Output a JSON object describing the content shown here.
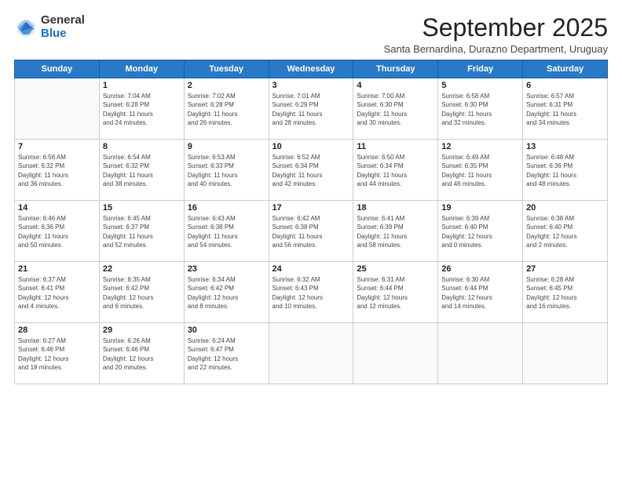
{
  "logo": {
    "general": "General",
    "blue": "Blue"
  },
  "title": "September 2025",
  "subtitle": "Santa Bernardina, Durazno Department, Uruguay",
  "weekdays": [
    "Sunday",
    "Monday",
    "Tuesday",
    "Wednesday",
    "Thursday",
    "Friday",
    "Saturday"
  ],
  "weeks": [
    [
      {
        "day": "",
        "info": ""
      },
      {
        "day": "1",
        "info": "Sunrise: 7:04 AM\nSunset: 6:28 PM\nDaylight: 11 hours\nand 24 minutes."
      },
      {
        "day": "2",
        "info": "Sunrise: 7:02 AM\nSunset: 6:28 PM\nDaylight: 11 hours\nand 26 minutes."
      },
      {
        "day": "3",
        "info": "Sunrise: 7:01 AM\nSunset: 6:29 PM\nDaylight: 11 hours\nand 28 minutes."
      },
      {
        "day": "4",
        "info": "Sunrise: 7:00 AM\nSunset: 6:30 PM\nDaylight: 11 hours\nand 30 minutes."
      },
      {
        "day": "5",
        "info": "Sunrise: 6:58 AM\nSunset: 6:30 PM\nDaylight: 11 hours\nand 32 minutes."
      },
      {
        "day": "6",
        "info": "Sunrise: 6:57 AM\nSunset: 6:31 PM\nDaylight: 11 hours\nand 34 minutes."
      }
    ],
    [
      {
        "day": "7",
        "info": "Sunrise: 6:56 AM\nSunset: 6:32 PM\nDaylight: 11 hours\nand 36 minutes."
      },
      {
        "day": "8",
        "info": "Sunrise: 6:54 AM\nSunset: 6:32 PM\nDaylight: 11 hours\nand 38 minutes."
      },
      {
        "day": "9",
        "info": "Sunrise: 6:53 AM\nSunset: 6:33 PM\nDaylight: 11 hours\nand 40 minutes."
      },
      {
        "day": "10",
        "info": "Sunrise: 6:52 AM\nSunset: 6:34 PM\nDaylight: 11 hours\nand 42 minutes."
      },
      {
        "day": "11",
        "info": "Sunrise: 6:50 AM\nSunset: 6:34 PM\nDaylight: 11 hours\nand 44 minutes."
      },
      {
        "day": "12",
        "info": "Sunrise: 6:49 AM\nSunset: 6:35 PM\nDaylight: 11 hours\nand 46 minutes."
      },
      {
        "day": "13",
        "info": "Sunrise: 6:48 AM\nSunset: 6:36 PM\nDaylight: 11 hours\nand 48 minutes."
      }
    ],
    [
      {
        "day": "14",
        "info": "Sunrise: 6:46 AM\nSunset: 6:36 PM\nDaylight: 11 hours\nand 50 minutes."
      },
      {
        "day": "15",
        "info": "Sunrise: 6:45 AM\nSunset: 6:37 PM\nDaylight: 11 hours\nand 52 minutes."
      },
      {
        "day": "16",
        "info": "Sunrise: 6:43 AM\nSunset: 6:38 PM\nDaylight: 11 hours\nand 54 minutes."
      },
      {
        "day": "17",
        "info": "Sunrise: 6:42 AM\nSunset: 6:38 PM\nDaylight: 11 hours\nand 56 minutes."
      },
      {
        "day": "18",
        "info": "Sunrise: 6:41 AM\nSunset: 6:39 PM\nDaylight: 11 hours\nand 58 minutes."
      },
      {
        "day": "19",
        "info": "Sunrise: 6:39 AM\nSunset: 6:40 PM\nDaylight: 12 hours\nand 0 minutes."
      },
      {
        "day": "20",
        "info": "Sunrise: 6:38 AM\nSunset: 6:40 PM\nDaylight: 12 hours\nand 2 minutes."
      }
    ],
    [
      {
        "day": "21",
        "info": "Sunrise: 6:37 AM\nSunset: 6:41 PM\nDaylight: 12 hours\nand 4 minutes."
      },
      {
        "day": "22",
        "info": "Sunrise: 6:35 AM\nSunset: 6:42 PM\nDaylight: 12 hours\nand 6 minutes."
      },
      {
        "day": "23",
        "info": "Sunrise: 6:34 AM\nSunset: 6:42 PM\nDaylight: 12 hours\nand 8 minutes."
      },
      {
        "day": "24",
        "info": "Sunrise: 6:32 AM\nSunset: 6:43 PM\nDaylight: 12 hours\nand 10 minutes."
      },
      {
        "day": "25",
        "info": "Sunrise: 6:31 AM\nSunset: 6:44 PM\nDaylight: 12 hours\nand 12 minutes."
      },
      {
        "day": "26",
        "info": "Sunrise: 6:30 AM\nSunset: 6:44 PM\nDaylight: 12 hours\nand 14 minutes."
      },
      {
        "day": "27",
        "info": "Sunrise: 6:28 AM\nSunset: 6:45 PM\nDaylight: 12 hours\nand 16 minutes."
      }
    ],
    [
      {
        "day": "28",
        "info": "Sunrise: 6:27 AM\nSunset: 6:46 PM\nDaylight: 12 hours\nand 18 minutes."
      },
      {
        "day": "29",
        "info": "Sunrise: 6:26 AM\nSunset: 6:46 PM\nDaylight: 12 hours\nand 20 minutes."
      },
      {
        "day": "30",
        "info": "Sunrise: 6:24 AM\nSunset: 6:47 PM\nDaylight: 12 hours\nand 22 minutes."
      },
      {
        "day": "",
        "info": ""
      },
      {
        "day": "",
        "info": ""
      },
      {
        "day": "",
        "info": ""
      },
      {
        "day": "",
        "info": ""
      }
    ]
  ]
}
